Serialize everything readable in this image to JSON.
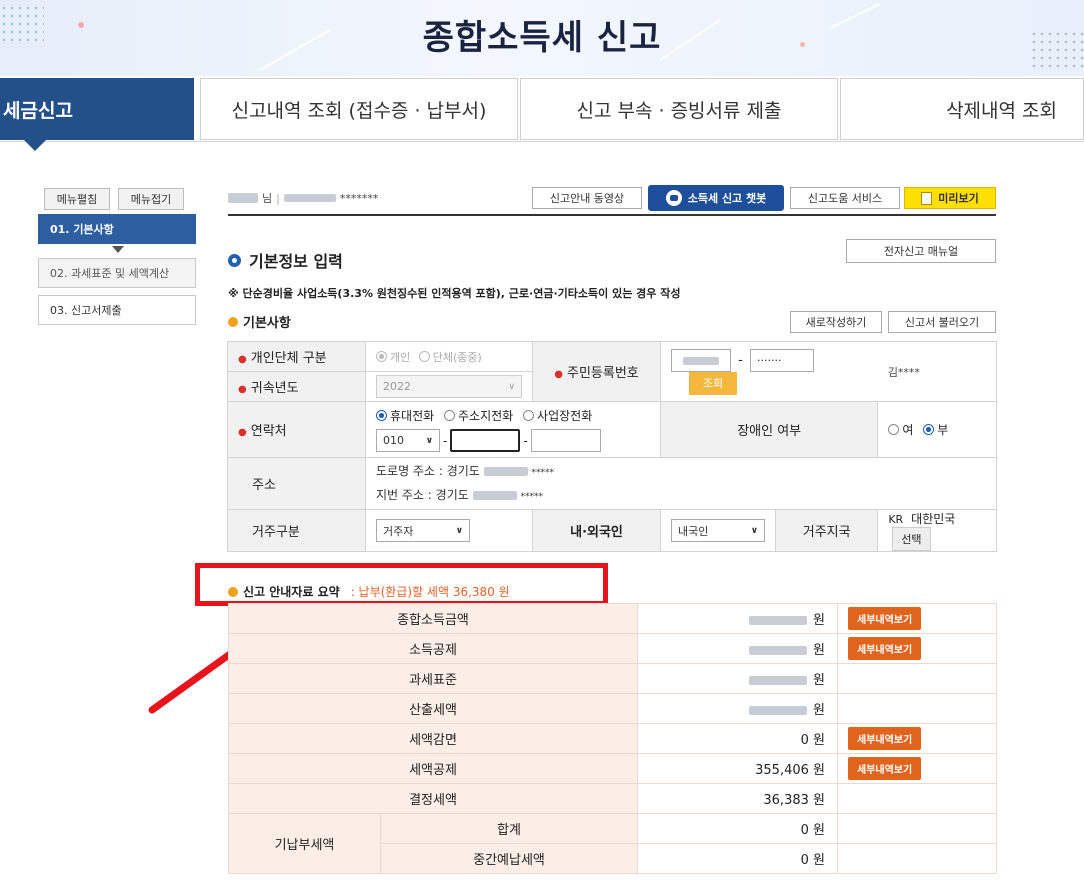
{
  "banner": {
    "title": "종합소득세 신고"
  },
  "tabs": [
    {
      "label": "세금신고"
    },
    {
      "label": "신고내역 조회 (접수증 · 납부서)"
    },
    {
      "label": "신고 부속 · 증빙서류 제출"
    },
    {
      "label": "삭제내역 조회"
    }
  ],
  "sidebar": {
    "expand_label": "메뉴펼침",
    "collapse_label": "메뉴접기",
    "items": [
      {
        "label": "01. 기본사항"
      },
      {
        "label": "02. 과세표준 및 세액계산"
      },
      {
        "label": "03. 신고서제출"
      }
    ]
  },
  "topbar": {
    "user_suffix": "님",
    "user_masked": "*******",
    "buttons": {
      "guide_video": "신고안내 동영상",
      "chatbot": "소득세 신고 챗봇",
      "help_service": "신고도움 서비스",
      "preview": "미리보기"
    }
  },
  "section": {
    "title": "기본정보 입력",
    "manual_button": "전자신고 매뉴얼",
    "notice": "※ 단순경비율 사업소득(3.3% 원천징수된 인적용역 포함), 근로·연금·기타소득이 있는 경우 작성",
    "basic_title": "기본사항",
    "new_button": "새로작성하기",
    "load_button": "신고서 불러오기"
  },
  "form": {
    "type_label": "개인단체 구분",
    "type_option1": "개인",
    "type_option2": "단체(종중)",
    "year_label": "귀속년도",
    "year_value": "2022",
    "rrn_label": "주민등록번호",
    "rrn_masked": "·······",
    "lookup_button": "조회",
    "name_masked": "김****",
    "contact_label": "연락처",
    "contact_options": [
      "휴대전화",
      "주소지전화",
      "사업장전화"
    ],
    "phone_prefix": "010",
    "dash": "-",
    "disability_label": "장애인 여부",
    "disability_yes": "여",
    "disability_no": "부",
    "address_label": "주소",
    "road_address_prefix": "도로명 주소 :",
    "jibun_address_prefix": "지번 주소 :",
    "province": "경기도",
    "address_mask": "*****",
    "residence_label": "거주구분",
    "residence_value": "거주자",
    "nationality_label": "내·외국인",
    "nationality_value": "내국인",
    "country_label": "거주지국",
    "country_code": "KR",
    "country_name": "대한민국",
    "select_button": "선택"
  },
  "summary": {
    "title": "신고 안내자료 요약",
    "highlight": ": 납부(환급)할 세액 36,380 원",
    "unit": "원",
    "detail_button": "세부내역보기",
    "rows": [
      {
        "label": "종합소득금액",
        "value": "",
        "detail": true
      },
      {
        "label": "소득공제",
        "value": "",
        "detail": true
      },
      {
        "label": "과세표준",
        "value": "",
        "detail": false
      },
      {
        "label": "산출세액",
        "value": "",
        "detail": false
      },
      {
        "label": "세액감면",
        "value": "0",
        "detail": true
      },
      {
        "label": "세액공제",
        "value": "355,406",
        "detail": true
      },
      {
        "label": "결정세액",
        "value": "36,383",
        "detail": false
      }
    ],
    "prepaid_label": "기납부세액",
    "total_label": "합계",
    "total_value": "0",
    "interim_label": "중간예납세액",
    "interim_value": "0"
  },
  "colors": {
    "tab_active": "#24508a",
    "sidebar_active": "#2c5ea0",
    "detail_button": "#e0641c",
    "highlight_box": "#e8141b",
    "arrow": "#e8141b",
    "summary_text": "#d9302a"
  }
}
